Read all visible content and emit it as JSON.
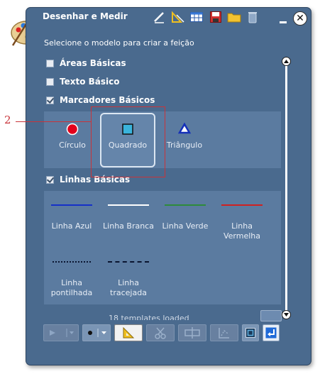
{
  "window": {
    "title": "Desenhar e Medir",
    "instruction": "Selecione o modelo para criar a feição",
    "close_symbol": "✕"
  },
  "toolbar_icons": [
    "pencil-icon",
    "measure-icon",
    "table-icon",
    "save-icon",
    "folder-icon",
    "trash-icon"
  ],
  "groups": [
    {
      "label": "Áreas Básicas",
      "checked": false
    },
    {
      "label": "Texto Básico",
      "checked": false
    },
    {
      "label": "Marcadores Básicos",
      "checked": true
    },
    {
      "label": "Linhas Básicas",
      "checked": true
    }
  ],
  "markers": [
    {
      "label": "Círculo",
      "symbol": "circle",
      "color": "#e3001b"
    },
    {
      "label": "Quadrado",
      "symbol": "square",
      "color": "#3ab4dc",
      "selected": true
    },
    {
      "label": "Triângulo",
      "symbol": "triangle",
      "color": "#1530b8"
    }
  ],
  "lines": [
    {
      "label1": "Linha Azul",
      "label2": "",
      "color": "#1530c8",
      "style": "solid"
    },
    {
      "label1": "Linha Branca",
      "label2": "",
      "color": "#ffffff",
      "style": "solid"
    },
    {
      "label1": "Linha Verde",
      "label2": "",
      "color": "#2e8b3a",
      "style": "solid"
    },
    {
      "label1": "Linha",
      "label2": "Vermelha",
      "color": "#d02020",
      "style": "solid"
    },
    {
      "label1": "Linha",
      "label2": "pontilhada",
      "color": "#0a1530",
      "style": "dotted"
    },
    {
      "label1": "Linha",
      "label2": "tracejada",
      "color": "#0a1530",
      "style": "dashed"
    }
  ],
  "status": "18 templates loaded",
  "annotation_number": "2",
  "colors": {
    "panel": "#4a6a8e",
    "template_area": "#5b7ba0",
    "annotation": "#c8343a"
  }
}
